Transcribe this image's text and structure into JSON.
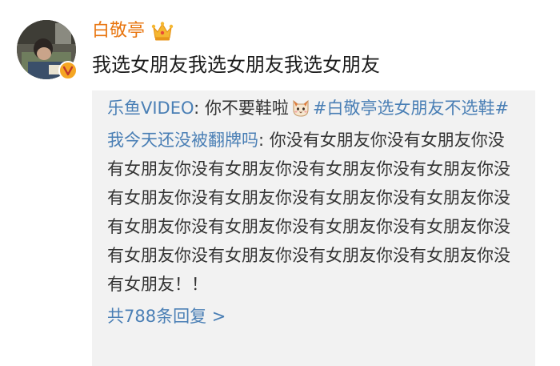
{
  "post": {
    "author": {
      "name": "白敬亭",
      "avatar_icon": "user-avatar-photo",
      "verified_icon": "verified-v-badge-icon",
      "vip_icon": "crown-icon"
    },
    "text": "我选女朋友我选女朋友我选女朋友"
  },
  "comments": [
    {
      "user": "乐鱼VIDEO",
      "separator": ": ",
      "text": "你不要鞋啦",
      "emoji_icon": "cat-face-emoji-icon",
      "hashtag": "#白敬亭选女朋友不选鞋#"
    },
    {
      "user": "我今天还没被翻牌吗",
      "separator": ": ",
      "text": "你没有女朋友你没有女朋友你没有女朋友你没有女朋友你没有女朋友你没有女朋友你没有女朋友你没有女朋友你没有女朋友你没有女朋友你没有女朋友你没有女朋友你没有女朋友你没有女朋友你没有女朋友你没有女朋友你没有女朋友你没有女朋友你没有女朋友！！"
    }
  ],
  "more_replies": "共788条回复 >",
  "colors": {
    "username": "#e8750f",
    "link": "#4a7fb5",
    "comment_bg": "#f2f2f2",
    "text": "#1a1a1a"
  }
}
